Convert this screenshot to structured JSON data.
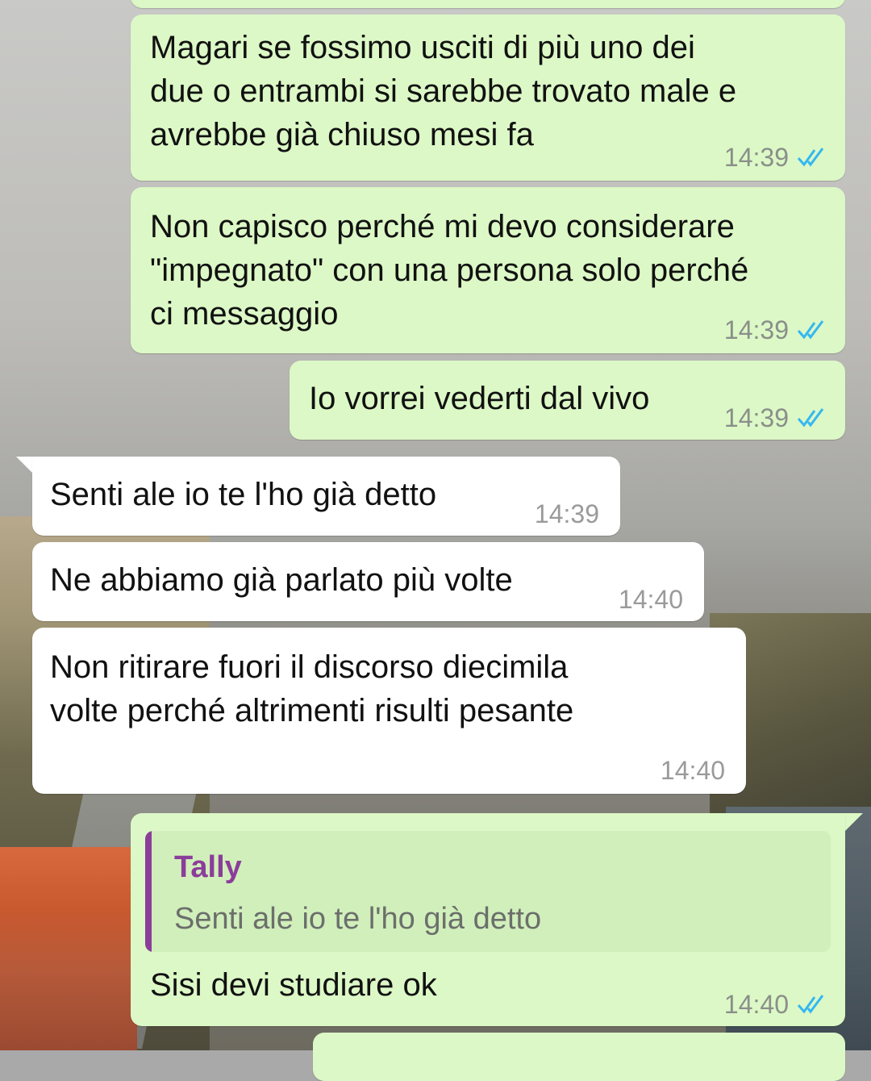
{
  "colors": {
    "outgoing_bubble": "#dcf8c6",
    "incoming_bubble": "#ffffff",
    "read_tick": "#34b7f1",
    "quote_author": "#8b3d9a"
  },
  "messages": [
    {
      "direction": "outgoing",
      "text": "Magari se fossimo usciti di più uno dei\ndue o entrambi si sarebbe trovato male e\navrebbe già chiuso mesi fa",
      "time": "14:39",
      "status_icon": "double-check-icon"
    },
    {
      "direction": "outgoing",
      "text": "Non capisco perché mi devo considerare\n\"impegnato\" con una persona solo perché\nci messaggio",
      "time": "14:39",
      "status_icon": "double-check-icon"
    },
    {
      "direction": "outgoing",
      "text": "Io vorrei vederti dal vivo",
      "time": "14:39",
      "status_icon": "double-check-icon"
    },
    {
      "direction": "incoming",
      "text": "Senti ale io te l'ho già detto",
      "time": "14:39"
    },
    {
      "direction": "incoming",
      "text": "Ne abbiamo già parlato più volte",
      "time": "14:40"
    },
    {
      "direction": "incoming",
      "text": "Non ritirare fuori il discorso diecimila\nvolte perché altrimenti risulti pesante",
      "time": "14:40"
    },
    {
      "direction": "outgoing",
      "quote": {
        "author": "Tally",
        "text": "Senti ale io te l'ho già detto"
      },
      "text": "Sisi devi studiare ok",
      "time": "14:40",
      "status_icon": "double-check-icon"
    }
  ]
}
